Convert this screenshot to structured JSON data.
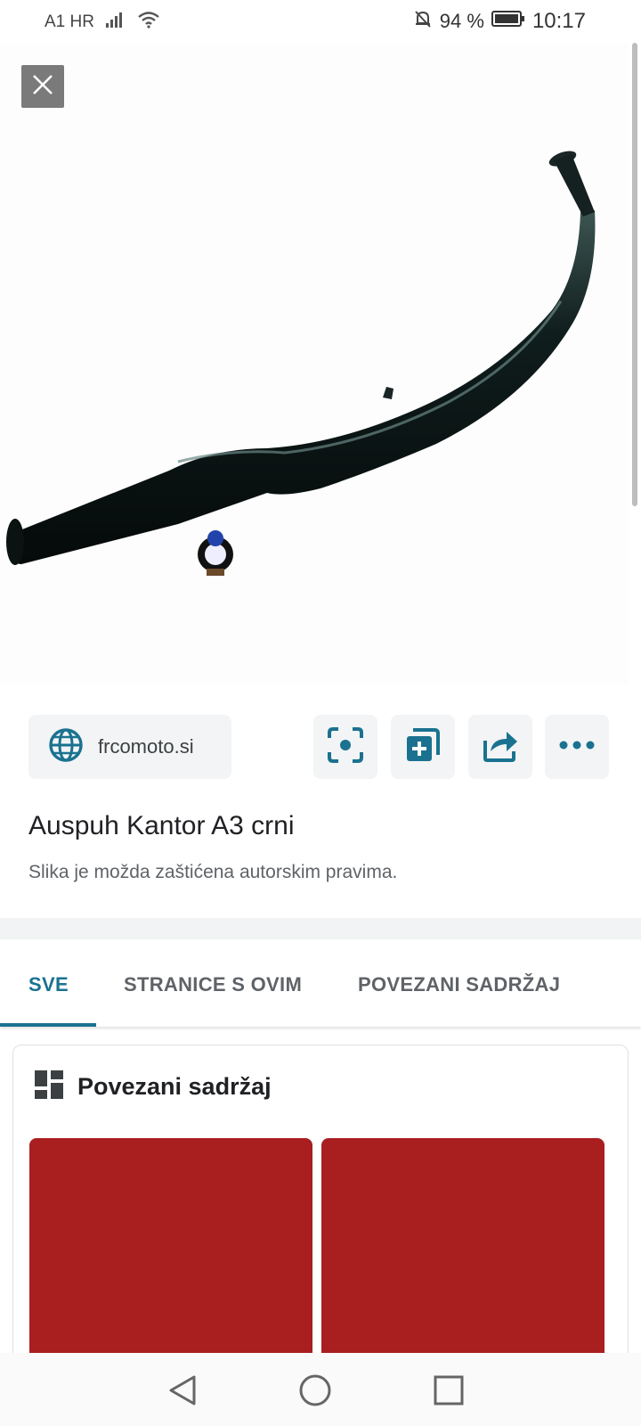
{
  "status_bar": {
    "carrier": "A1 HR",
    "battery_percent": "94 %",
    "time": "10:17"
  },
  "source": {
    "domain": "frcomoto.si"
  },
  "image": {
    "title": "Auspuh Kantor A3 crni",
    "copyright_note": "Slika je možda zaštićena autorskim pravima."
  },
  "tabs": [
    {
      "label": "SVE",
      "active": true
    },
    {
      "label": "STRANICE S OVIM",
      "active": false
    },
    {
      "label": "POVEZANI SADRŽAJ",
      "active": false
    }
  ],
  "related": {
    "title": "Povezani sadržaj",
    "thumb_color": "#a91e1f"
  },
  "colors": {
    "accent": "#1a7290",
    "chip_bg": "#f3f4f5"
  },
  "icons": {
    "close": "close-icon",
    "globe": "globe-icon",
    "lens": "lens-icon",
    "collection": "add-to-collection-icon",
    "share": "share-icon",
    "more": "more-icon"
  }
}
